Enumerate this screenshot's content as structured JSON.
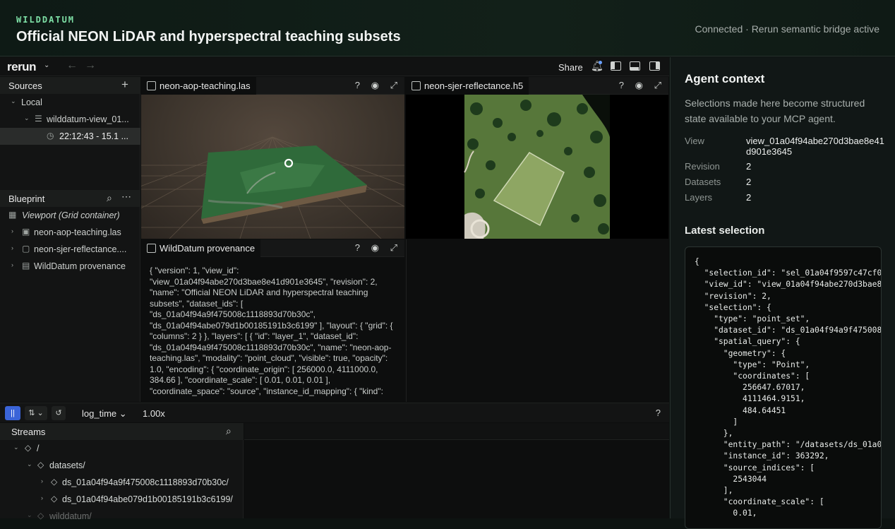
{
  "app": {
    "brand": "WILDDATUM",
    "title": "Official NEON LiDAR and hyperspectral teaching subsets",
    "status": "Connected · Rerun semantic bridge active"
  },
  "viewer": {
    "logo": "rerun",
    "share_label": "Share",
    "sources": {
      "title": "Sources",
      "local": "Local",
      "recording": "wilddatum-view_01...",
      "time_entry": "22:12:43 - 15.1 ..."
    },
    "blueprint": {
      "title": "Blueprint",
      "viewport": "Viewport (Grid container)",
      "items": [
        "neon-aop-teaching.las",
        "neon-sjer-reflectance....",
        "WildDatum provenance"
      ]
    },
    "tabs": {
      "view1": "neon-aop-teaching.las",
      "view2": "neon-sjer-reflectance.h5",
      "view3": "WildDatum provenance"
    },
    "help": "?",
    "provenance_text": "{ \"version\": 1, \"view_id\": \"view_01a04f94abe270d3bae8e41d901e3645\", \"revision\": 2, \"name\": \"Official NEON LiDAR and hyperspectral teaching subsets\", \"dataset_ids\": [ \"ds_01a04f94a9f475008c1118893d70b30c\", \"ds_01a04f94abe079d1b00185191b3c6199\" ], \"layout\": { \"grid\": { \"columns\": 2 } }, \"layers\": [ { \"id\": \"layer_1\", \"dataset_id\": \"ds_01a04f94a9f475008c1118893d70b30c\", \"name\": \"neon-aop-teaching.las\", \"modality\": \"point_cloud\", \"visible\": true, \"opacity\": 1.0, \"encoding\": { \"coordinate_origin\": [ 256000.0, 4111000.0, 384.66 ], \"coordinate_scale\": [ 0.01, 0.01, 0.01 ], \"coordinate_space\": \"source\", \"instance_id_mapping\": { \"kind\":",
    "timeline": {
      "name": "log_time",
      "speed": "1.00x"
    },
    "streams": {
      "title": "Streams",
      "rows": [
        "/",
        "datasets/",
        "ds_01a04f94a9f475008c1118893d70b30c/",
        "ds_01a04f94abe079d1b00185191b3c6199/",
        "wilddatum/"
      ]
    }
  },
  "agent": {
    "title": "Agent context",
    "description": "Selections made here become structured state available to your MCP agent.",
    "view_key": "View",
    "view_val": "view_01a04f94abe270d3bae8e41d901e3645",
    "revision_key": "Revision",
    "revision_val": "2",
    "datasets_key": "Datasets",
    "datasets_val": "2",
    "layers_key": "Layers",
    "layers_val": "2",
    "latest_title": "Latest selection",
    "selection_json": "{\n  \"selection_id\": \"sel_01a04f9597c47cf0b\n  \"view_id\": \"view_01a04f94abe270d3bae8e\n  \"revision\": 2,\n  \"selection\": {\n    \"type\": \"point_set\",\n    \"dataset_id\": \"ds_01a04f94a9f4750085\n    \"spatial_query\": {\n      \"geometry\": {\n        \"type\": \"Point\",\n        \"coordinates\": [\n          256647.67017,\n          4111464.9151,\n          484.64451\n        ]\n      },\n      \"entity_path\": \"/datasets/ds_01a04\n      \"instance_id\": 363292,\n      \"source_indices\": [\n        2543044\n      ],\n      \"coordinate_scale\": [\n        0.01,"
  }
}
